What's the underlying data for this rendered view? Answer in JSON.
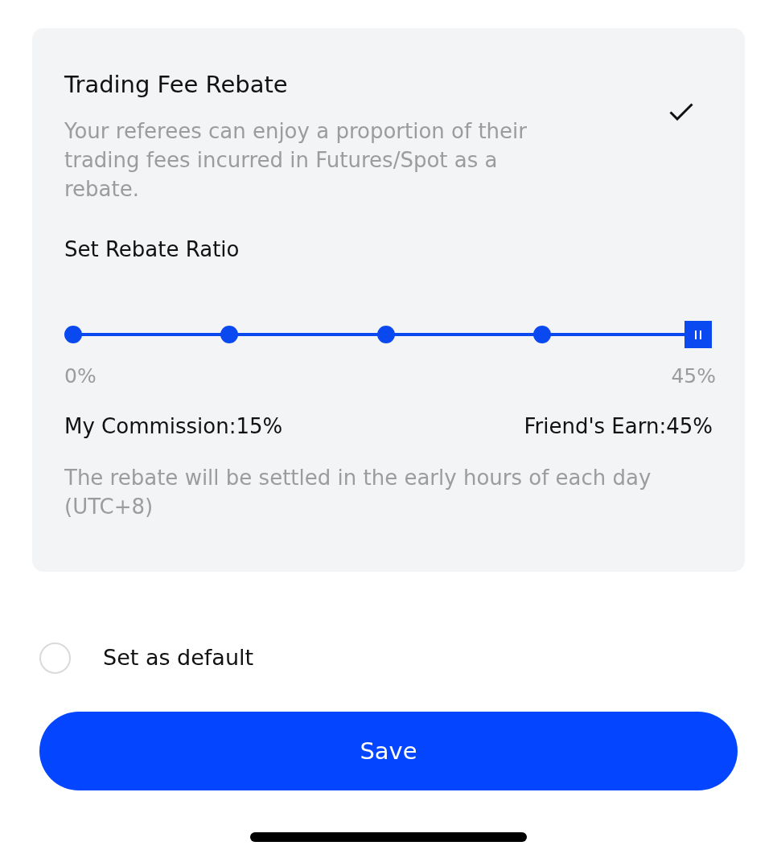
{
  "card": {
    "selected": true,
    "title": "Trading Fee Rebate",
    "description": "Your referees can enjoy a proportion of their trading fees incurred in Futures/Spot as a rebate.",
    "ratio_label": "Set Rebate Ratio",
    "slider": {
      "level": 1,
      "min_label": "0%",
      "max_label": "45%"
    },
    "my_commission": "My Commission:15%",
    "friends_earn": "Friend's Earn:45%",
    "note": "The rebate will be settled in the early hours of each day (UTC+8)"
  },
  "default_option": {
    "label": "Set as default",
    "checked": false
  },
  "save_button": {
    "label": "Save"
  }
}
